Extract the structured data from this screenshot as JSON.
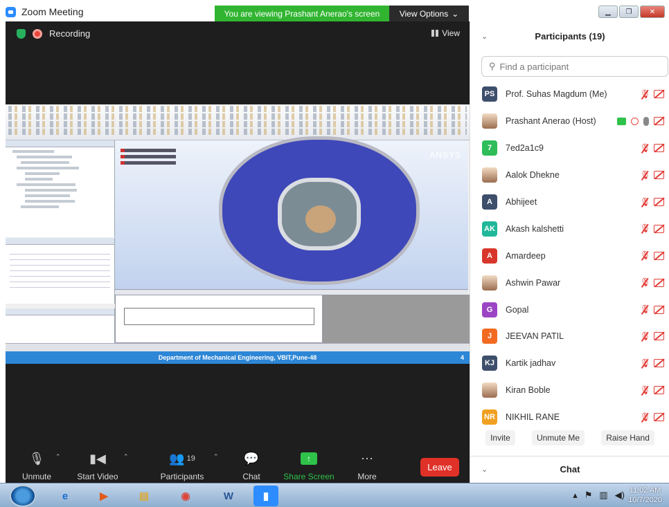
{
  "window": {
    "title": "Zoom Meeting",
    "banner": "You are viewing Prashant Anerao's screen",
    "view_options": "View Options"
  },
  "meeting": {
    "recording_label": "Recording",
    "view_label": "View"
  },
  "shared_screen": {
    "brand": "ANSYS",
    "footer": "Department of Mechanical Engineering, VBIT,Pune-48",
    "page": "4"
  },
  "controls": [
    {
      "label": "Unmute",
      "icon": "microphone-muted-icon"
    },
    {
      "label": "Start Video",
      "icon": "camera-off-icon"
    },
    {
      "label": "Participants",
      "icon": "participants-icon",
      "count": "19"
    },
    {
      "label": "Chat",
      "icon": "chat-bubble-icon"
    },
    {
      "label": "Share Screen",
      "icon": "share-screen-icon"
    },
    {
      "label": "More",
      "icon": "more-dots-icon"
    }
  ],
  "leave_label": "Leave",
  "panel": {
    "title": "Participants (19)",
    "search_placeholder": "Find a participant",
    "buttons": [
      "Invite",
      "Unmute Me",
      "Raise Hand"
    ],
    "chat_title": "Chat"
  },
  "participants": [
    {
      "initials": "PS",
      "name": "Prof. Suhas Magdum (Me)",
      "color": "#3e4f6b"
    },
    {
      "initials": "",
      "name": "Prashant Anerao (Host)",
      "color": "#6b5a4a",
      "photo": true,
      "host": true
    },
    {
      "initials": "7",
      "name": "7ed2a1c9",
      "color": "#2ebd59"
    },
    {
      "initials": "",
      "name": "Aalok Dhekne",
      "color": "#c9a888",
      "photo": true
    },
    {
      "initials": "A",
      "name": "Abhijeet",
      "color": "#3e4f6b"
    },
    {
      "initials": "AK",
      "name": "Akash kalshetti",
      "color": "#1fb89a"
    },
    {
      "initials": "A",
      "name": "Amardeep",
      "color": "#d9362b"
    },
    {
      "initials": "",
      "name": "Ashwin Pawar",
      "color": "#b48a74",
      "photo": true
    },
    {
      "initials": "G",
      "name": "Gopal",
      "color": "#9b45c4"
    },
    {
      "initials": "J",
      "name": "JEEVAN PATIL",
      "color": "#f26a22"
    },
    {
      "initials": "KJ",
      "name": "Kartik jadhav",
      "color": "#3e4f6b"
    },
    {
      "initials": "",
      "name": "Kiran Boble",
      "color": "#d0c4b8",
      "photo": true
    },
    {
      "initials": "NR",
      "name": "NIKHIL RANE",
      "color": "#f0a021"
    }
  ],
  "taskbar": {
    "time": "11:02 AM",
    "date": "10/7/2020"
  }
}
